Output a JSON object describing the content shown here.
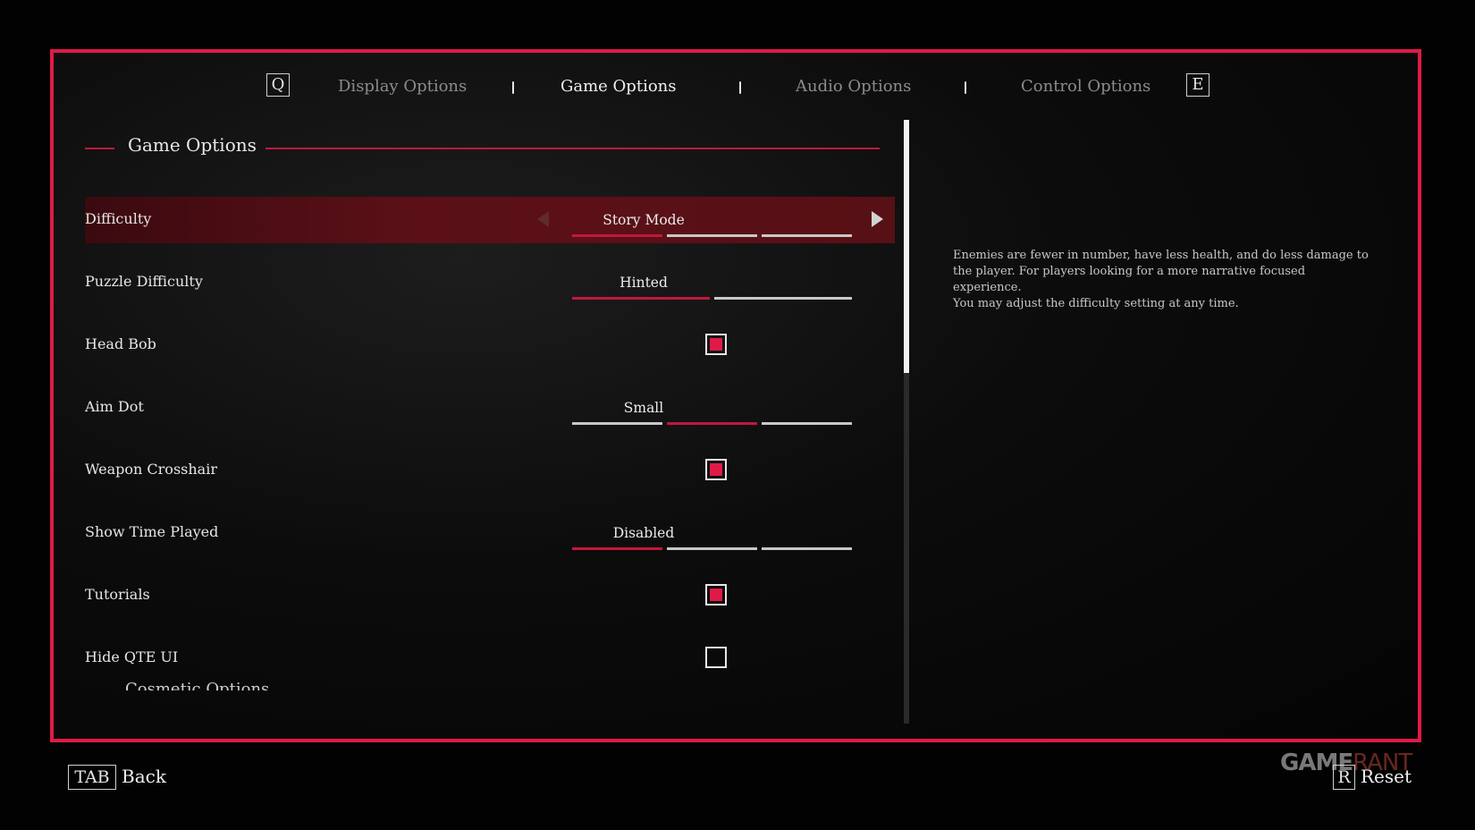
{
  "tabs": {
    "prev_key": "Q",
    "next_key": "E",
    "items": [
      {
        "label": "Display Options",
        "active": false
      },
      {
        "label": "Game Options",
        "active": true
      },
      {
        "label": "Audio Options",
        "active": false
      },
      {
        "label": "Control Options",
        "active": false
      }
    ]
  },
  "section": {
    "title": "Game Options",
    "next_title": "Cosmetic Options"
  },
  "settings": [
    {
      "label": "Difficulty",
      "type": "selector",
      "value": "Story Mode",
      "option_count": 3,
      "selected_index": 0,
      "highlighted": true
    },
    {
      "label": "Puzzle Difficulty",
      "type": "selector",
      "value": "Hinted",
      "option_count": 2,
      "selected_index": 0
    },
    {
      "label": "Head Bob",
      "type": "checkbox",
      "checked": true
    },
    {
      "label": "Aim Dot",
      "type": "selector",
      "value": "Small",
      "option_count": 3,
      "selected_index": 1
    },
    {
      "label": "Weapon Crosshair",
      "type": "checkbox",
      "checked": true
    },
    {
      "label": "Show Time Played",
      "type": "selector",
      "value": "Disabled",
      "option_count": 3,
      "selected_index": 0
    },
    {
      "label": "Tutorials",
      "type": "checkbox",
      "checked": true
    },
    {
      "label": "Hide QTE UI",
      "type": "checkbox",
      "checked": false
    }
  ],
  "description": {
    "line1": "Enemies are fewer in number, have less health, and do less damage to the player. For players looking for a more narrative focused experience.",
    "line2": "You may adjust the difficulty setting at any time."
  },
  "footer": {
    "back_key": "TAB",
    "back_label": "Back",
    "reset_key": "R",
    "reset_label": "Reset"
  },
  "watermark": {
    "game": "GAME",
    "rant": "RANT"
  },
  "colors": {
    "accent": "#e01a47",
    "highlight_row": "#5b1017",
    "text": "#e6e6e6",
    "inactive_tab": "#8c8c8c"
  }
}
